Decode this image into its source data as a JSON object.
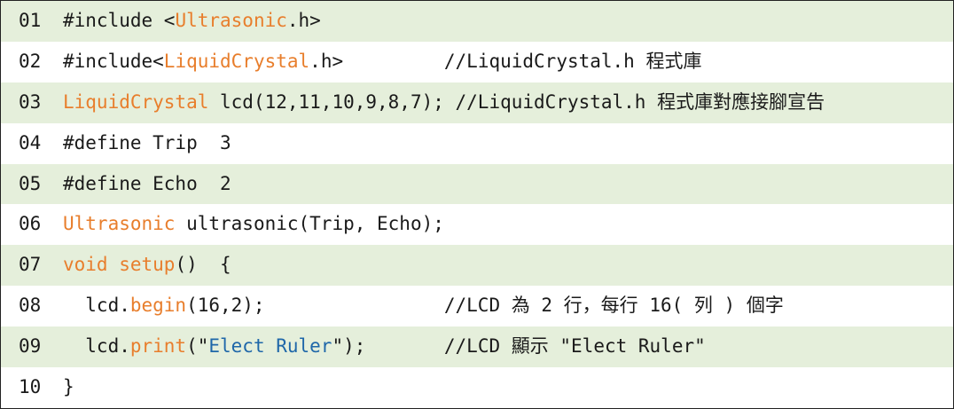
{
  "colors": {
    "keyword": "#e87e2c",
    "string": "#1f67a9",
    "row_shade": "#e5efdb",
    "text": "#1a1a1a"
  },
  "lines": [
    {
      "num": "01",
      "parts": [
        {
          "t": "#include <"
        },
        {
          "t": "Ultrasonic",
          "c": "kw"
        },
        {
          "t": ".h>"
        }
      ]
    },
    {
      "num": "02",
      "parts": [
        {
          "t": "#include<"
        },
        {
          "t": "LiquidCrystal",
          "c": "kw"
        },
        {
          "t": ".h>         //LiquidCrystal.h "
        },
        {
          "t": "程式庫",
          "c": "cjk"
        }
      ]
    },
    {
      "num": "03",
      "parts": [
        {
          "t": "LiquidCrystal",
          "c": "kw"
        },
        {
          "t": " lcd(12,11,10,9,8,7); //LiquidCrystal.h "
        },
        {
          "t": "程式庫對應接腳宣告",
          "c": "cjk"
        }
      ]
    },
    {
      "num": "04",
      "parts": [
        {
          "t": "#define Trip  3"
        }
      ]
    },
    {
      "num": "05",
      "parts": [
        {
          "t": "#define Echo  2"
        }
      ]
    },
    {
      "num": "06",
      "parts": [
        {
          "t": "Ultrasonic",
          "c": "kw"
        },
        {
          "t": " ultrasonic(Trip, Echo);"
        }
      ]
    },
    {
      "num": "07",
      "parts": [
        {
          "t": "void",
          "c": "kw"
        },
        {
          "t": " "
        },
        {
          "t": "setup",
          "c": "kw"
        },
        {
          "t": "()  {"
        }
      ]
    },
    {
      "num": "08",
      "parts": [
        {
          "t": "  lcd."
        },
        {
          "t": "begin",
          "c": "kw"
        },
        {
          "t": "(16,2);                //LCD "
        },
        {
          "t": "為",
          "c": "cjk"
        },
        {
          "t": " 2 "
        },
        {
          "t": "行，每行",
          "c": "cjk"
        },
        {
          "t": " 16( "
        },
        {
          "t": "列",
          "c": "cjk"
        },
        {
          "t": " ) "
        },
        {
          "t": "個字",
          "c": "cjk"
        }
      ]
    },
    {
      "num": "09",
      "parts": [
        {
          "t": "  lcd."
        },
        {
          "t": "print",
          "c": "kw"
        },
        {
          "t": "(\""
        },
        {
          "t": "Elect Ruler",
          "c": "str"
        },
        {
          "t": "\");       //LCD "
        },
        {
          "t": "顯示",
          "c": "cjk"
        },
        {
          "t": " \"Elect Ruler\""
        }
      ]
    },
    {
      "num": "10",
      "parts": [
        {
          "t": "}"
        }
      ]
    }
  ]
}
